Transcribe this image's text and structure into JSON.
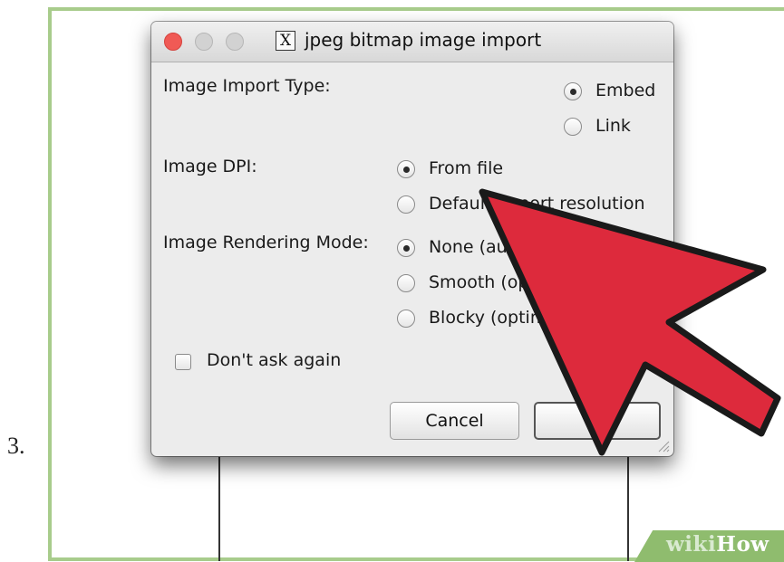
{
  "step": {
    "number": "3."
  },
  "dialog": {
    "title": "jpeg bitmap image import",
    "app_icon": "X",
    "import_type": {
      "label": "Image Import Type:",
      "options": [
        {
          "label": "Embed",
          "checked": true
        },
        {
          "label": "Link",
          "checked": false
        }
      ]
    },
    "dpi": {
      "label": "Image DPI:",
      "options": [
        {
          "label": "From file",
          "checked": true
        },
        {
          "label": "Default import resolution",
          "checked": false
        }
      ]
    },
    "rendering": {
      "label": "Image Rendering Mode:",
      "options": [
        {
          "label": "None (auto)",
          "checked": true
        },
        {
          "label": "Smooth (optimizeQuality)",
          "checked": false
        },
        {
          "label": "Blocky (optimizeSpeed)",
          "checked": false
        }
      ]
    },
    "dont_ask": {
      "label": "Don't ask again",
      "checked": false
    },
    "buttons": {
      "cancel": "Cancel",
      "ok": "OK"
    }
  },
  "watermark": {
    "part1": "wiki",
    "part2": "How"
  },
  "colors": {
    "arrow_fill": "#dd2a3c",
    "frame_border": "#a8cc8c",
    "close_button": "#f05a55"
  }
}
